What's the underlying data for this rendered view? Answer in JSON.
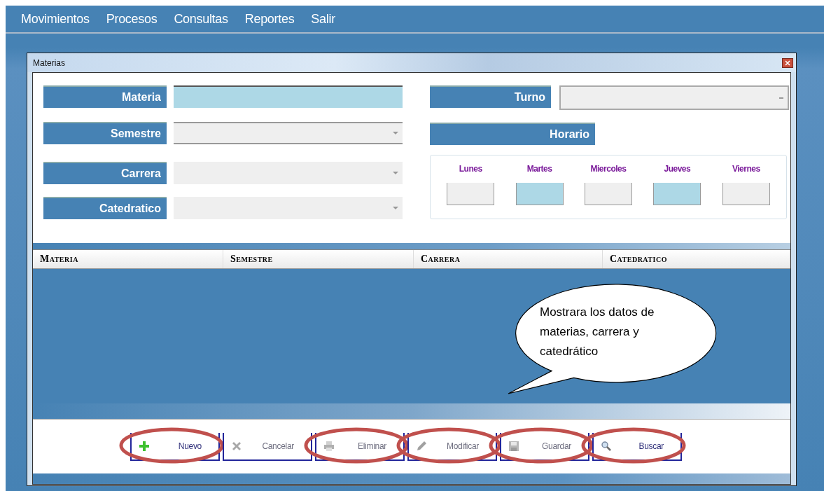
{
  "menu": [
    {
      "label": "Movimientos"
    },
    {
      "label": "Procesos"
    },
    {
      "label": "Consultas"
    },
    {
      "label": "Reportes"
    },
    {
      "label": "Salir"
    }
  ],
  "window": {
    "title": "Materias"
  },
  "form_left": [
    {
      "label": "Materia",
      "kind": "text"
    },
    {
      "label": "Semestre",
      "kind": "combo"
    },
    {
      "label": "Carrera",
      "kind": "combo"
    },
    {
      "label": "Catedratico",
      "kind": "combo"
    }
  ],
  "turno": {
    "label": "Turno"
  },
  "horario": {
    "label": "Horario"
  },
  "days": [
    {
      "label": "Lunes",
      "selected": false
    },
    {
      "label": "Martes",
      "selected": true
    },
    {
      "label": "Miercoles",
      "selected": false
    },
    {
      "label": "Jueves",
      "selected": true
    },
    {
      "label": "Viernes",
      "selected": false
    }
  ],
  "table": {
    "columns": [
      "Materia",
      "Semestre",
      "Carrera",
      "Catedratico"
    ]
  },
  "callout": {
    "text": "Mostrara los datos de materias, carrera y catedrático"
  },
  "buttons": [
    {
      "label": "Nuevo",
      "disabled": false,
      "circled": true
    },
    {
      "label": "Cancelar",
      "disabled": true,
      "circled": false
    },
    {
      "label": "Eliminar",
      "disabled": true,
      "circled": true
    },
    {
      "label": "Modificar",
      "disabled": true,
      "circled": true
    },
    {
      "label": "Guardar",
      "disabled": true,
      "circled": true
    },
    {
      "label": "Buscar",
      "disabled": false,
      "circled": true
    }
  ]
}
